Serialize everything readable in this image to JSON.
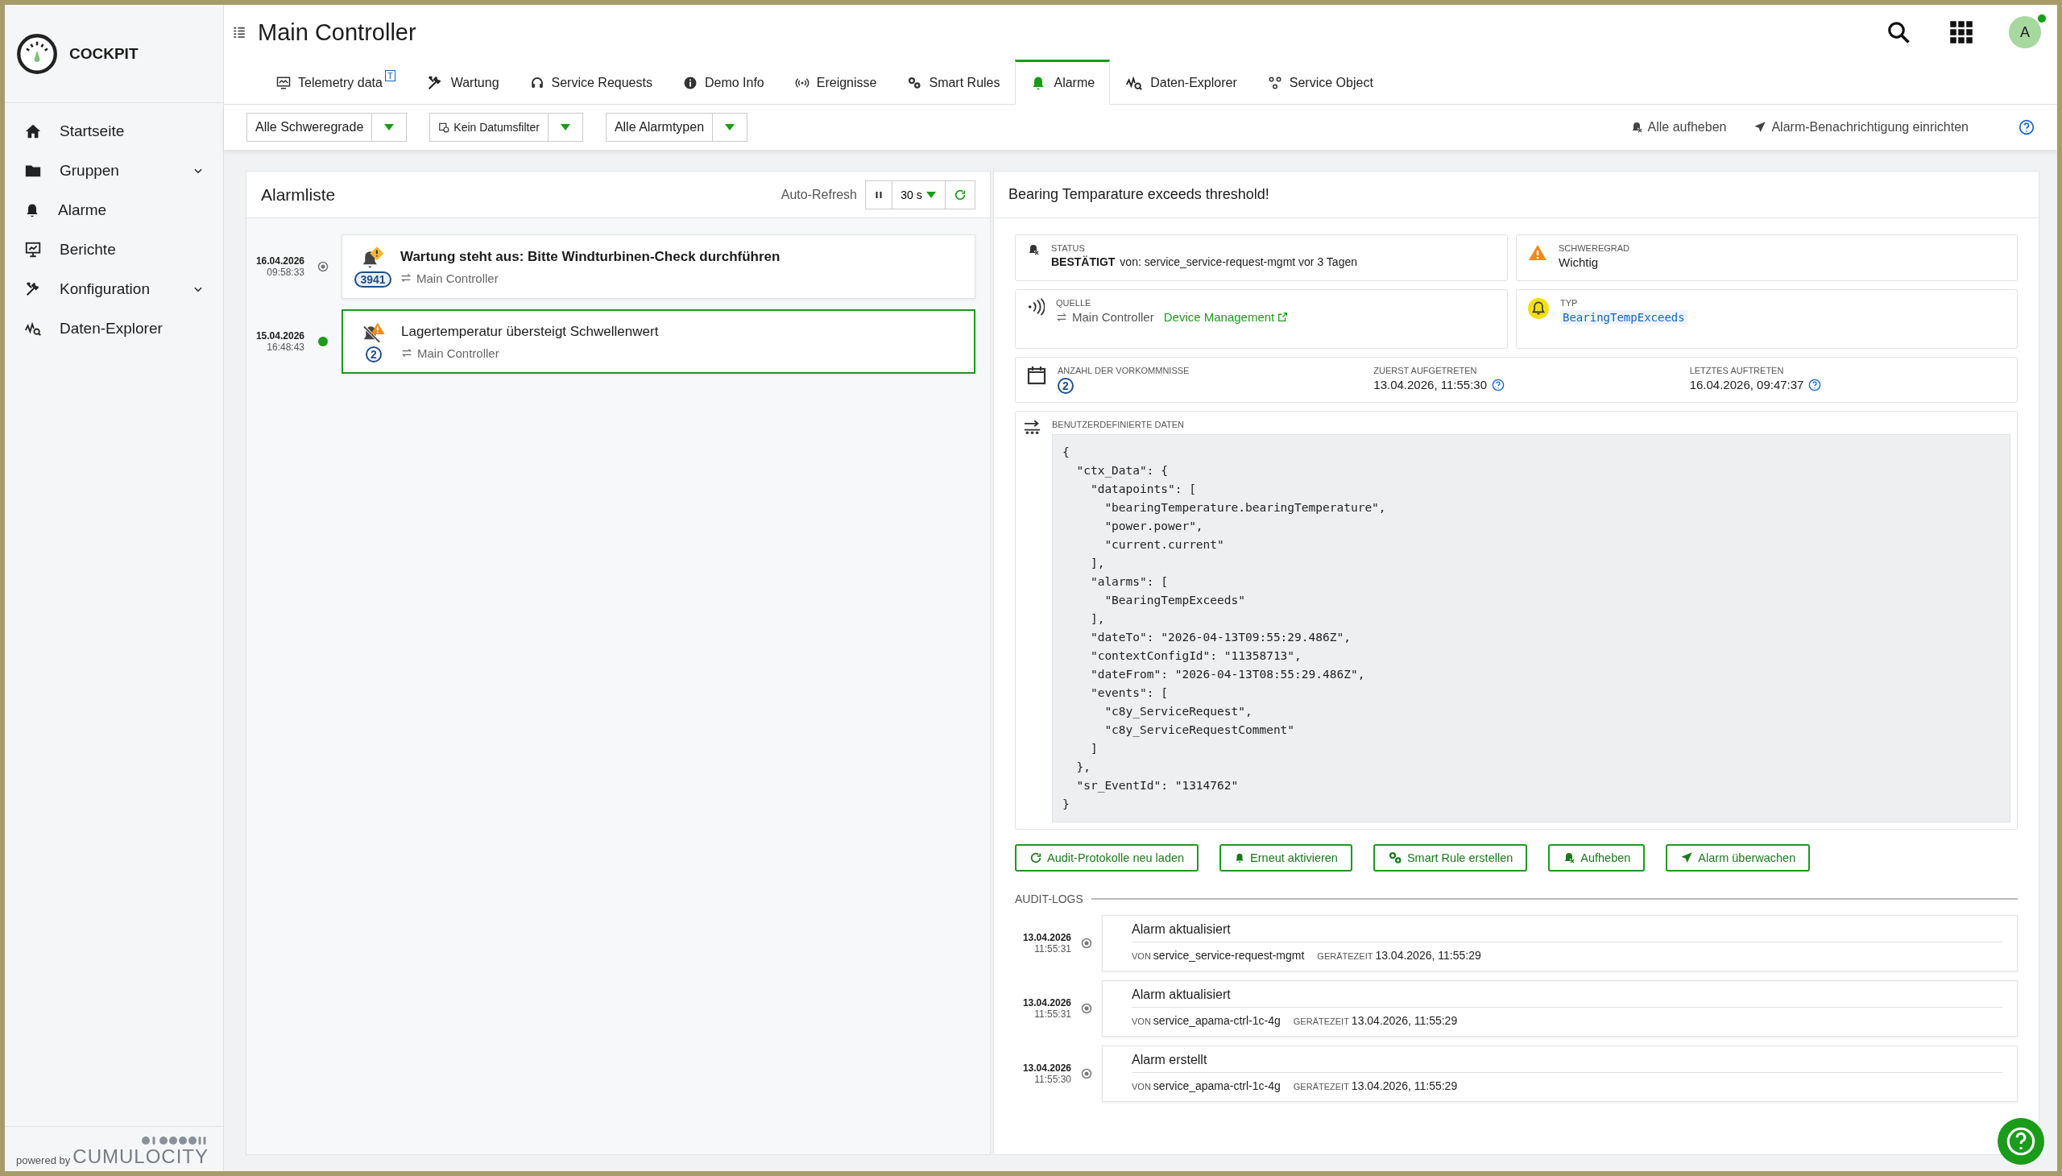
{
  "app": {
    "name": "COCKPIT",
    "powered_by": "powered by",
    "brand": "CUMULOCITY"
  },
  "sidebar": {
    "items": [
      {
        "label": "Startseite",
        "kind": "link"
      },
      {
        "label": "Gruppen",
        "kind": "group"
      },
      {
        "label": "Alarme",
        "kind": "link"
      },
      {
        "label": "Berichte",
        "kind": "link"
      },
      {
        "label": "Konfiguration",
        "kind": "group"
      },
      {
        "label": "Daten-Explorer",
        "kind": "link"
      }
    ]
  },
  "header": {
    "title": "Main Controller",
    "avatar": "A",
    "online": true
  },
  "tabs": [
    {
      "label": "Telemetry data",
      "badge": "T",
      "selected": false
    },
    {
      "label": "Wartung",
      "selected": false
    },
    {
      "label": "Service Requests",
      "selected": false
    },
    {
      "label": "Demo Info",
      "selected": false
    },
    {
      "label": "Ereignisse",
      "selected": false
    },
    {
      "label": "Smart Rules",
      "selected": false
    },
    {
      "label": "Alarme",
      "selected": true
    },
    {
      "label": "Daten-Explorer",
      "selected": false
    },
    {
      "label": "Service Object",
      "selected": false
    }
  ],
  "filters": [
    {
      "value": "Alle Schweregrade"
    },
    {
      "value": "Kein Datumsfilter",
      "kind": "date"
    },
    {
      "value": "Alle Alarmtypen"
    }
  ],
  "actions": [
    {
      "label": "Alle aufheben",
      "kind": "clear"
    },
    {
      "label": "Alarm-Benachrichtigung einrichten",
      "kind": "notify"
    }
  ],
  "alarm_list": {
    "title": "Alarmliste",
    "auto_refresh": "Auto-Refresh",
    "interval": "30 s",
    "alarms": [
      {
        "date": "16.04.2026",
        "time": "09:58:33",
        "title": "Wartung steht aus: Bitte Windturbinen-Check durchführen",
        "source": "Main Controller",
        "count": "3941",
        "acknowledged": false,
        "kind": "warning",
        "selected": false
      },
      {
        "date": "15.04.2026",
        "time": "16:48:43",
        "title": "Lagertemperatur übersteigt Schwellenwert",
        "source": "Main Controller",
        "count": "2",
        "acknowledged": true,
        "kind": "major",
        "selected": true
      }
    ]
  },
  "detail": {
    "title": "Bearing Temparature exceeds threshold!",
    "status": {
      "label": "STATUS",
      "value": "**BESTÄTIGT** von: service_service-request-mgmt vor 3 Tagen"
    },
    "severity": {
      "label": "SCHWEREGRAD",
      "value": "Wichtig"
    },
    "source": {
      "label": "QUELLE",
      "value": "Main Controller",
      "link": "Device Management"
    },
    "type": {
      "label": "TYP",
      "value": "BearingTempExceeds"
    },
    "occurrences": {
      "label": "ANZAHL DER VORKOMMNISSE",
      "count": "2",
      "first_label": "ZUERST AUFGETRETEN",
      "first": "13.04.2026, 11:55:30",
      "last_label": "LETZTES AUFTRETEN",
      "last": "16.04.2026, 09:47:37"
    },
    "custom_data": {
      "label": "BENUTZERDEFINIERTE DATEN",
      "lines": [
        "{",
        "  \"ctx_Data\": {",
        "    \"datapoints\": [",
        "      \"bearingTemperature.bearingTemperature\",",
        "      \"power.power\",",
        "      \"current.current\"",
        "    ],",
        "    \"alarms\": [",
        "      \"BearingTempExceeds\"",
        "    ],",
        "    \"dateTo\": \"2026-04-13T09:55:29.486Z\",",
        "    \"contextConfigId\": \"11358713\",",
        "    \"dateFrom\": \"2026-04-13T08:55:29.486Z\",",
        "    \"events\": [",
        "      \"c8y_ServiceRequest\",",
        "      \"c8y_ServiceRequestComment\"",
        "    ]",
        "  },",
        "  \"sr_EventId\": \"1314762\"",
        "}"
      ]
    }
  },
  "buttons": [
    {
      "label": "Audit-Protokolle neu laden",
      "kind": "reload"
    },
    {
      "label": "Erneut aktivieren",
      "kind": "bell"
    },
    {
      "label": "Smart Rule erstellen",
      "kind": "gears"
    },
    {
      "label": "Aufheben",
      "kind": "clear"
    },
    {
      "label": "Alarm überwachen",
      "kind": "send"
    }
  ],
  "audit": {
    "label": "AUDIT-LOGS",
    "logs": [
      {
        "date": "13.04.2026",
        "time": "11:55:31",
        "title": "Alarm aktualisiert",
        "by_label": "VON",
        "by": "service_service-request-mgmt",
        "time_label": "GERÄTEZEIT",
        "device_time": "13.04.2026, 11:55:29"
      },
      {
        "date": "13.04.2026",
        "time": "11:55:31",
        "title": "Alarm aktualisiert",
        "by_label": "VON",
        "by": "service_apama-ctrl-1c-4g",
        "time_label": "GERÄTEZEIT",
        "device_time": "13.04.2026, 11:55:29"
      },
      {
        "date": "13.04.2026",
        "time": "11:55:30",
        "title": "Alarm erstellt",
        "by_label": "VON",
        "by": "service_apama-ctrl-1c-4g",
        "time_label": "GERÄTEZEIT",
        "device_time": "13.04.2026, 11:55:29"
      }
    ]
  }
}
